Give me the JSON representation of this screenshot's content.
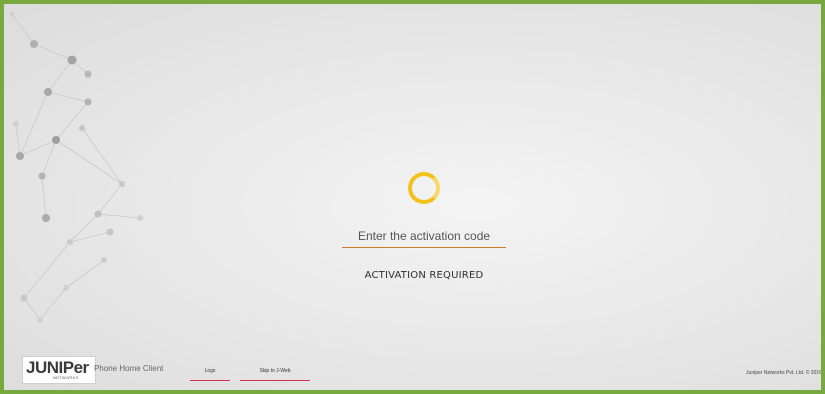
{
  "activation": {
    "placeholder": "Enter the activation code",
    "status": "ACTIVATION REQUIRED"
  },
  "footer": {
    "logo_word": "JUNIPer",
    "logo_sub": "NETWORKS",
    "client_name": "Phone Home Client",
    "logs_label": "Logs",
    "jweb_label": "Skip to J-Web",
    "copyright": "Juniper Networks Pvt. Ltd. © 2016"
  },
  "colors": {
    "frame_border": "#77a93f",
    "spinner": "#f2c11a",
    "input_underline": "#d17a2b",
    "link_underline": "#d2344a"
  }
}
